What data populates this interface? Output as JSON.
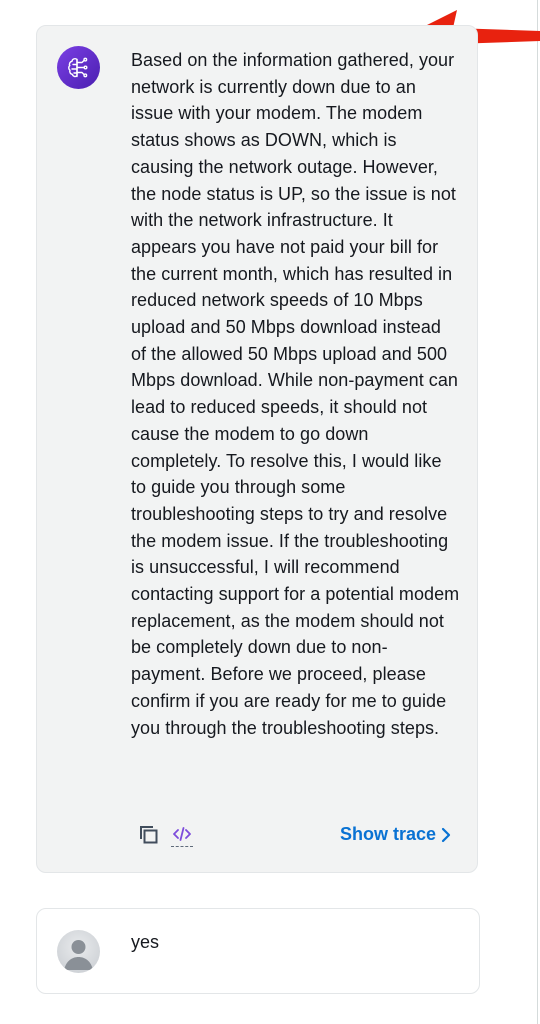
{
  "conversation": {
    "agent_message": {
      "avatar_icon": "brain-circuit-icon",
      "text": "Based on the information gathered, your network is currently down due to an issue with your modem. The modem status shows as DOWN, which is causing the network outage. However, the node status is UP, so the issue is not with the network infrastructure. It appears you have not paid your bill for the current month, which has resulted in reduced network speeds of 10 Mbps upload and 50 Mbps download instead of the allowed 50 Mbps upload and 500 Mbps download. While non-payment can lead to reduced speeds, it should not cause the modem to go down completely. To resolve this, I would like to guide you through some troubleshooting steps to try and resolve the modem issue. If the troubleshooting is unsuccessful, I will recommend contacting support for a potential modem replacement, as the modem should not be completely down due to non-payment. Before we proceed, please confirm if you are ready for me to guide you through the troubleshooting steps.",
      "actions": {
        "copy_icon": "copy-icon",
        "code_icon": "code-icon",
        "show_trace_label": "Show trace"
      }
    },
    "user_message": {
      "avatar_icon": "user-avatar-icon",
      "text": "yes"
    }
  },
  "colors": {
    "annotation_arrow": "#e8220f",
    "link": "#0972d3",
    "agent_avatar": "#5a2bc8",
    "card_bg": "#f2f3f3"
  }
}
